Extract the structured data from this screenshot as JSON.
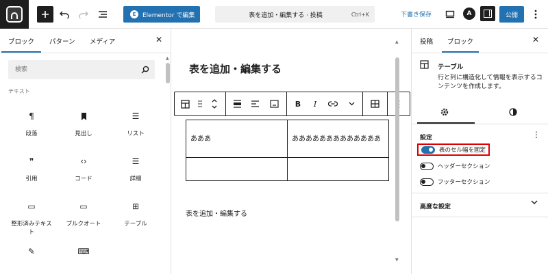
{
  "header": {
    "elementor_label": "Elementor で編集",
    "elementor_icon_text": "E",
    "command_title": "表を追加・編集する · 投稿",
    "command_shortcut": "Ctrl+K",
    "draft_label": "下書き保存",
    "publish_label": "公開",
    "ast_logo_text": "A"
  },
  "inserter": {
    "tabs": [
      "ブロック",
      "パターン",
      "メディア"
    ],
    "search_placeholder": "検索",
    "category_label": "テキスト",
    "blocks": [
      {
        "label": "段落",
        "icon": "¶"
      },
      {
        "label": "見出し",
        "icon": "🔖"
      },
      {
        "label": "リスト",
        "icon": "☰"
      },
      {
        "label": "引用",
        "icon": "❞"
      },
      {
        "label": "コード",
        "icon": "‹›"
      },
      {
        "label": "詳細",
        "icon": "☰"
      },
      {
        "label": "整形済みテキスト",
        "icon": "▭"
      },
      {
        "label": "プルクオート",
        "icon": "▭"
      },
      {
        "label": "テーブル",
        "icon": "⊞"
      },
      {
        "label": "",
        "icon": "✎"
      },
      {
        "label": "",
        "icon": "⌨"
      }
    ]
  },
  "canvas": {
    "post_title": "表を追加・編集する",
    "table": [
      [
        "あああ",
        "あああああああああああああ"
      ],
      [
        "",
        ""
      ]
    ],
    "paragraph": "表を追加・編集する"
  },
  "settings": {
    "tabs": [
      "投稿",
      "ブロック"
    ],
    "block_name": "テーブル",
    "block_desc": "行と列に構造化して情報を表示するコンテンツを作成します。",
    "section_title": "設定",
    "toggles": [
      {
        "label": "表のセル幅を固定",
        "on": true
      },
      {
        "label": "ヘッダーセクション",
        "on": false
      },
      {
        "label": "フッターセクション",
        "on": false
      }
    ],
    "advanced_label": "高度な設定"
  },
  "colors": {
    "accent": "#2271b1",
    "highlight": "#dd0000"
  }
}
